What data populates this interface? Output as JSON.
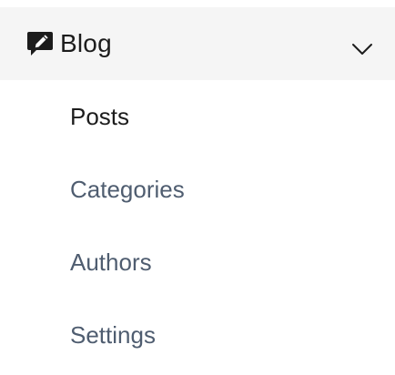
{
  "section": {
    "title": "Blog",
    "icon": "blog-comment-edit-icon",
    "expand_icon": "chevron-down-icon",
    "background": "#f5f5f5"
  },
  "items": [
    {
      "label": "Posts",
      "active": true
    },
    {
      "label": "Categories",
      "active": false
    },
    {
      "label": "Authors",
      "active": false
    },
    {
      "label": "Settings",
      "active": false
    }
  ],
  "colors": {
    "active_text": "#1c1c1c",
    "inactive_text": "#4f5d70"
  }
}
